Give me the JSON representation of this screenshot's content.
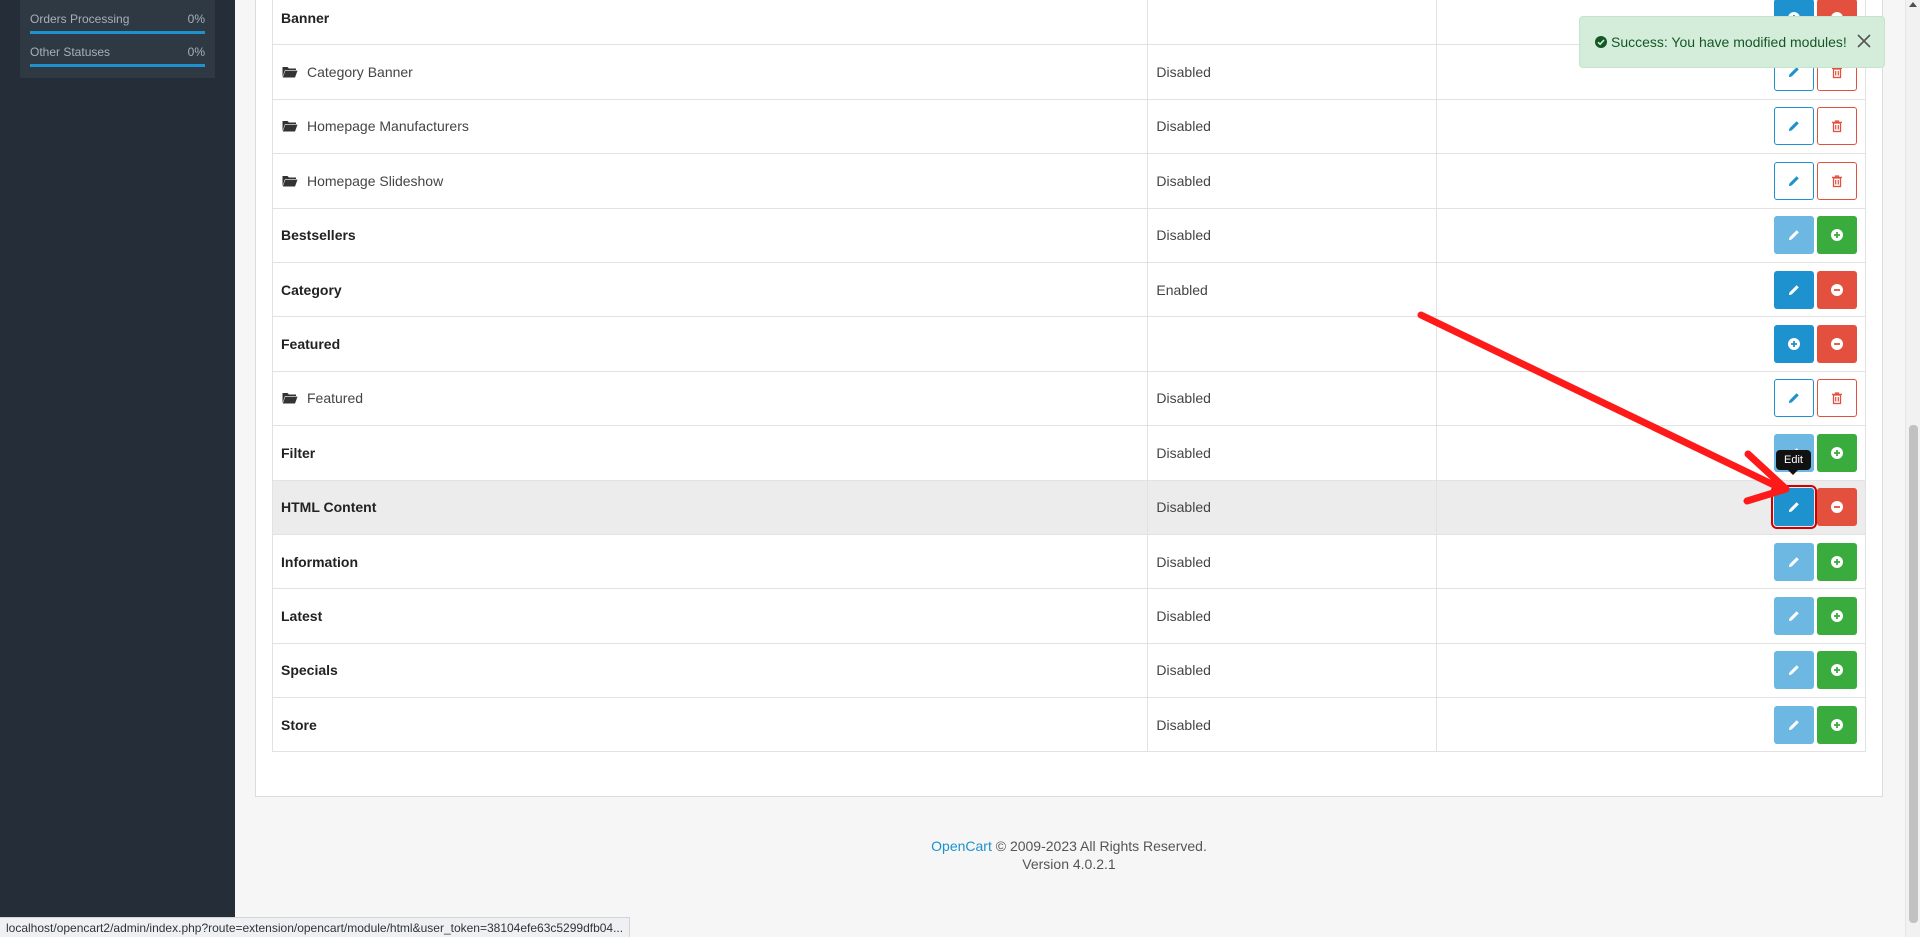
{
  "sidebar": {
    "stats": [
      {
        "label": "Orders Processing",
        "percent": "0%",
        "fill": 1.0
      },
      {
        "label": "Other Statuses",
        "percent": "0%",
        "fill": 1.0
      }
    ]
  },
  "alert": {
    "message": "Success: You have modified modules!",
    "icon": "check-circle-icon",
    "close_icon": "close-icon",
    "color": "#d4edda"
  },
  "table": {
    "rows": [
      {
        "type": "extension",
        "name": "Banner",
        "status": "",
        "actions": [
          "add-blue",
          "uninstall"
        ]
      },
      {
        "type": "module",
        "name": "Category Banner",
        "status": "Disabled",
        "actions": [
          "edit-outline",
          "delete-outline"
        ]
      },
      {
        "type": "module",
        "name": "Homepage Manufacturers",
        "status": "Disabled",
        "actions": [
          "edit-outline",
          "delete-outline"
        ]
      },
      {
        "type": "module",
        "name": "Homepage Slideshow",
        "status": "Disabled",
        "actions": [
          "edit-outline",
          "delete-outline"
        ]
      },
      {
        "type": "extension",
        "name": "Bestsellers",
        "status": "Disabled",
        "actions": [
          "edit-light",
          "install"
        ]
      },
      {
        "type": "extension",
        "name": "Category",
        "status": "Enabled",
        "actions": [
          "edit-solid",
          "uninstall"
        ]
      },
      {
        "type": "extension",
        "name": "Featured",
        "status": "",
        "actions": [
          "add-blue",
          "uninstall"
        ]
      },
      {
        "type": "module",
        "name": "Featured",
        "status": "Disabled",
        "actions": [
          "edit-outline",
          "delete-outline"
        ]
      },
      {
        "type": "extension",
        "name": "Filter",
        "status": "Disabled",
        "actions": [
          "edit-light",
          "install"
        ]
      },
      {
        "type": "extension",
        "name": "HTML Content",
        "status": "Disabled",
        "actions": [
          "edit-solid",
          "uninstall"
        ],
        "highlighted": true
      },
      {
        "type": "extension",
        "name": "Information",
        "status": "Disabled",
        "actions": [
          "edit-light",
          "install"
        ]
      },
      {
        "type": "extension",
        "name": "Latest",
        "status": "Disabled",
        "actions": [
          "edit-light",
          "install"
        ]
      },
      {
        "type": "extension",
        "name": "Specials",
        "status": "Disabled",
        "actions": [
          "edit-light",
          "install"
        ]
      },
      {
        "type": "extension",
        "name": "Store",
        "status": "Disabled",
        "actions": [
          "edit-light",
          "install"
        ]
      }
    ]
  },
  "tooltip": {
    "text": "Edit"
  },
  "footer": {
    "link_text": "OpenCart",
    "copyright": " © 2009-2023 All Rights Reserved.",
    "version": "Version 4.0.2.1"
  },
  "statusbar": {
    "url": "localhost/opencart2/admin/index.php?route=extension/opencart/module/html&user_token=38104efe63c5299dfb04..."
  },
  "colors": {
    "primary": "#1e91cf",
    "danger": "#e3503e",
    "success": "#3aab3d",
    "sidebar": "#252e38",
    "annotation": "#ff0000"
  }
}
